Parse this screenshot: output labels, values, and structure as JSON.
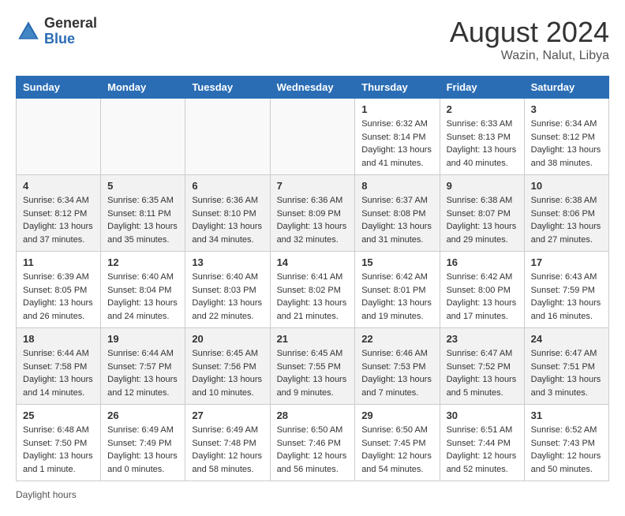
{
  "header": {
    "logo_general": "General",
    "logo_blue": "Blue",
    "month_year": "August 2024",
    "location": "Wazin, Nalut, Libya"
  },
  "days_of_week": [
    "Sunday",
    "Monday",
    "Tuesday",
    "Wednesday",
    "Thursday",
    "Friday",
    "Saturday"
  ],
  "footer": {
    "daylight_label": "Daylight hours"
  },
  "weeks": [
    {
      "days": [
        {
          "num": "",
          "info": ""
        },
        {
          "num": "",
          "info": ""
        },
        {
          "num": "",
          "info": ""
        },
        {
          "num": "",
          "info": ""
        },
        {
          "num": "1",
          "info": "Sunrise: 6:32 AM\nSunset: 8:14 PM\nDaylight: 13 hours and 41 minutes."
        },
        {
          "num": "2",
          "info": "Sunrise: 6:33 AM\nSunset: 8:13 PM\nDaylight: 13 hours and 40 minutes."
        },
        {
          "num": "3",
          "info": "Sunrise: 6:34 AM\nSunset: 8:12 PM\nDaylight: 13 hours and 38 minutes."
        }
      ]
    },
    {
      "days": [
        {
          "num": "4",
          "info": "Sunrise: 6:34 AM\nSunset: 8:12 PM\nDaylight: 13 hours and 37 minutes."
        },
        {
          "num": "5",
          "info": "Sunrise: 6:35 AM\nSunset: 8:11 PM\nDaylight: 13 hours and 35 minutes."
        },
        {
          "num": "6",
          "info": "Sunrise: 6:36 AM\nSunset: 8:10 PM\nDaylight: 13 hours and 34 minutes."
        },
        {
          "num": "7",
          "info": "Sunrise: 6:36 AM\nSunset: 8:09 PM\nDaylight: 13 hours and 32 minutes."
        },
        {
          "num": "8",
          "info": "Sunrise: 6:37 AM\nSunset: 8:08 PM\nDaylight: 13 hours and 31 minutes."
        },
        {
          "num": "9",
          "info": "Sunrise: 6:38 AM\nSunset: 8:07 PM\nDaylight: 13 hours and 29 minutes."
        },
        {
          "num": "10",
          "info": "Sunrise: 6:38 AM\nSunset: 8:06 PM\nDaylight: 13 hours and 27 minutes."
        }
      ]
    },
    {
      "days": [
        {
          "num": "11",
          "info": "Sunrise: 6:39 AM\nSunset: 8:05 PM\nDaylight: 13 hours and 26 minutes."
        },
        {
          "num": "12",
          "info": "Sunrise: 6:40 AM\nSunset: 8:04 PM\nDaylight: 13 hours and 24 minutes."
        },
        {
          "num": "13",
          "info": "Sunrise: 6:40 AM\nSunset: 8:03 PM\nDaylight: 13 hours and 22 minutes."
        },
        {
          "num": "14",
          "info": "Sunrise: 6:41 AM\nSunset: 8:02 PM\nDaylight: 13 hours and 21 minutes."
        },
        {
          "num": "15",
          "info": "Sunrise: 6:42 AM\nSunset: 8:01 PM\nDaylight: 13 hours and 19 minutes."
        },
        {
          "num": "16",
          "info": "Sunrise: 6:42 AM\nSunset: 8:00 PM\nDaylight: 13 hours and 17 minutes."
        },
        {
          "num": "17",
          "info": "Sunrise: 6:43 AM\nSunset: 7:59 PM\nDaylight: 13 hours and 16 minutes."
        }
      ]
    },
    {
      "days": [
        {
          "num": "18",
          "info": "Sunrise: 6:44 AM\nSunset: 7:58 PM\nDaylight: 13 hours and 14 minutes."
        },
        {
          "num": "19",
          "info": "Sunrise: 6:44 AM\nSunset: 7:57 PM\nDaylight: 13 hours and 12 minutes."
        },
        {
          "num": "20",
          "info": "Sunrise: 6:45 AM\nSunset: 7:56 PM\nDaylight: 13 hours and 10 minutes."
        },
        {
          "num": "21",
          "info": "Sunrise: 6:45 AM\nSunset: 7:55 PM\nDaylight: 13 hours and 9 minutes."
        },
        {
          "num": "22",
          "info": "Sunrise: 6:46 AM\nSunset: 7:53 PM\nDaylight: 13 hours and 7 minutes."
        },
        {
          "num": "23",
          "info": "Sunrise: 6:47 AM\nSunset: 7:52 PM\nDaylight: 13 hours and 5 minutes."
        },
        {
          "num": "24",
          "info": "Sunrise: 6:47 AM\nSunset: 7:51 PM\nDaylight: 13 hours and 3 minutes."
        }
      ]
    },
    {
      "days": [
        {
          "num": "25",
          "info": "Sunrise: 6:48 AM\nSunset: 7:50 PM\nDaylight: 13 hours and 1 minute."
        },
        {
          "num": "26",
          "info": "Sunrise: 6:49 AM\nSunset: 7:49 PM\nDaylight: 13 hours and 0 minutes."
        },
        {
          "num": "27",
          "info": "Sunrise: 6:49 AM\nSunset: 7:48 PM\nDaylight: 12 hours and 58 minutes."
        },
        {
          "num": "28",
          "info": "Sunrise: 6:50 AM\nSunset: 7:46 PM\nDaylight: 12 hours and 56 minutes."
        },
        {
          "num": "29",
          "info": "Sunrise: 6:50 AM\nSunset: 7:45 PM\nDaylight: 12 hours and 54 minutes."
        },
        {
          "num": "30",
          "info": "Sunrise: 6:51 AM\nSunset: 7:44 PM\nDaylight: 12 hours and 52 minutes."
        },
        {
          "num": "31",
          "info": "Sunrise: 6:52 AM\nSunset: 7:43 PM\nDaylight: 12 hours and 50 minutes."
        }
      ]
    }
  ]
}
